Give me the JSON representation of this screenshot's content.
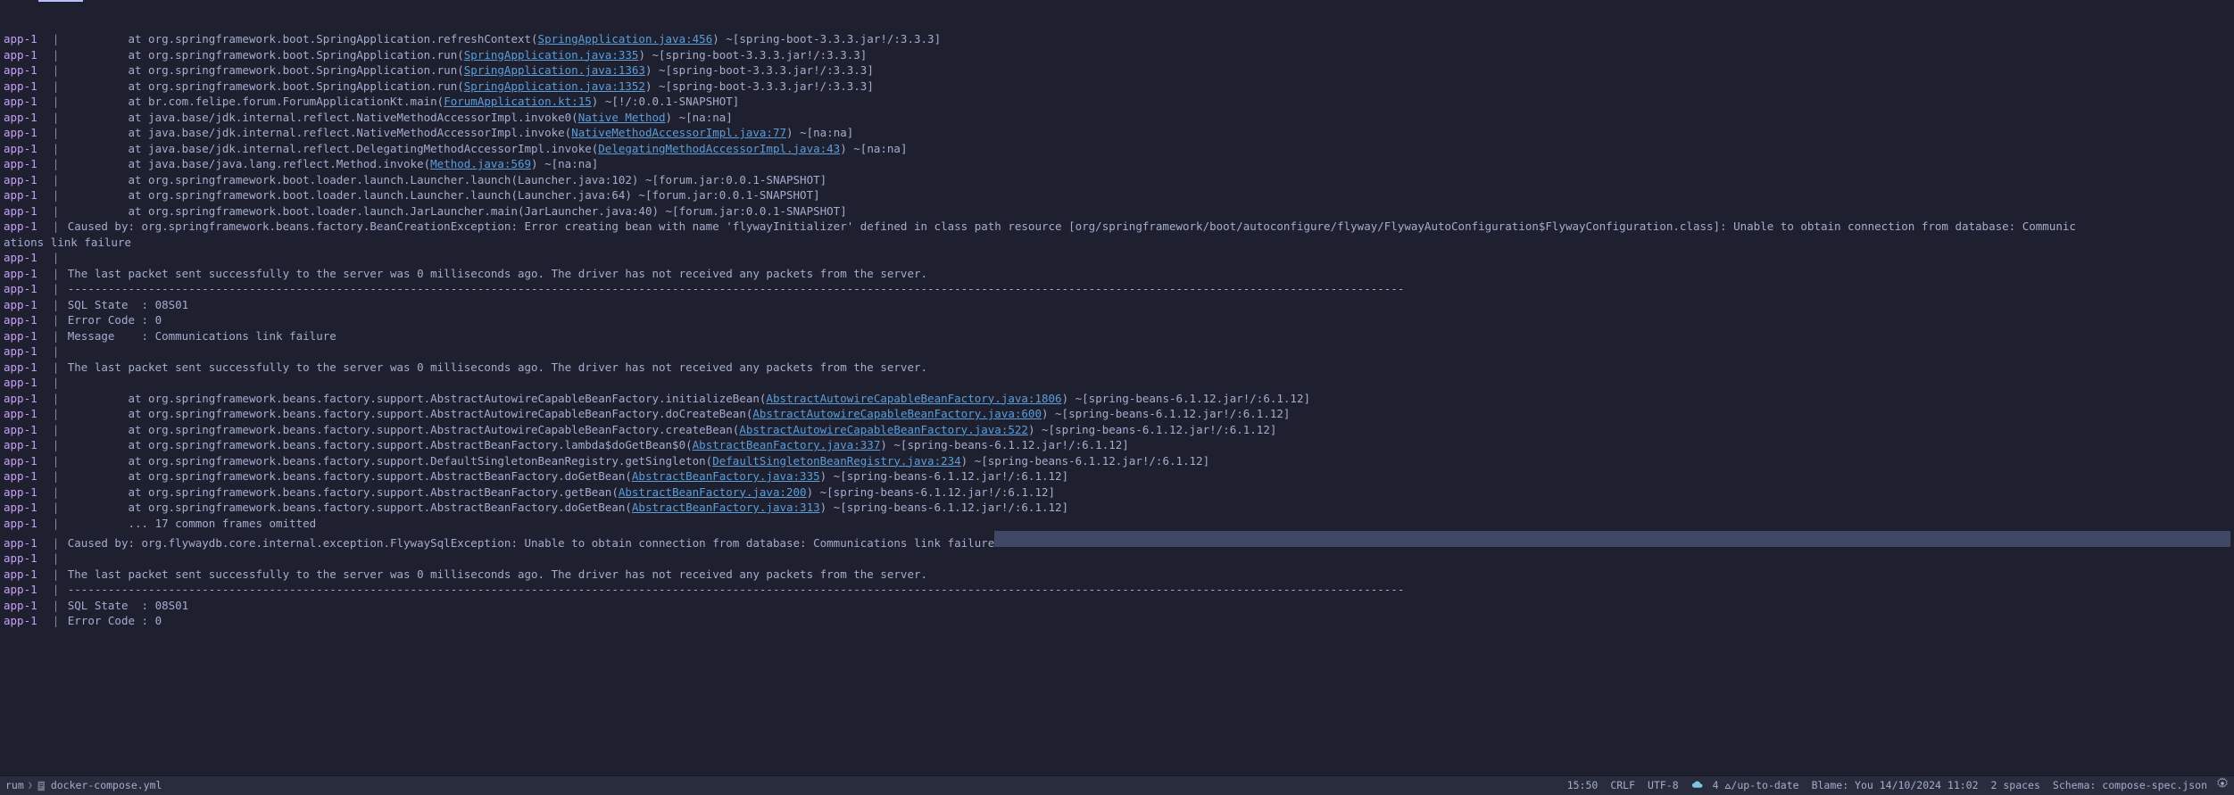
{
  "log": {
    "prefix": "app-1",
    "lines": [
      {
        "type": "stack",
        "indent": "         ",
        "pre": "at org.springframework.boot.SpringApplication.refreshContext(",
        "link": "SpringApplication.java:456",
        "post": ") ~[spring-boot-3.3.3.jar!/:3.3.3]"
      },
      {
        "type": "stack",
        "indent": "         ",
        "pre": "at org.springframework.boot.SpringApplication.run(",
        "link": "SpringApplication.java:335",
        "post": ") ~[spring-boot-3.3.3.jar!/:3.3.3]"
      },
      {
        "type": "stack",
        "indent": "         ",
        "pre": "at org.springframework.boot.SpringApplication.run(",
        "link": "SpringApplication.java:1363",
        "post": ") ~[spring-boot-3.3.3.jar!/:3.3.3]"
      },
      {
        "type": "stack",
        "indent": "         ",
        "pre": "at org.springframework.boot.SpringApplication.run(",
        "link": "SpringApplication.java:1352",
        "post": ") ~[spring-boot-3.3.3.jar!/:3.3.3]"
      },
      {
        "type": "stack",
        "indent": "         ",
        "pre": "at br.com.felipe.forum.ForumApplicationKt.main(",
        "link": "ForumApplication.kt:15",
        "post": ") ~[!/:0.0.1-SNAPSHOT]"
      },
      {
        "type": "stack",
        "indent": "         ",
        "pre": "at java.base/jdk.internal.reflect.NativeMethodAccessorImpl.invoke0(",
        "link": "Native Method",
        "post": ") ~[na:na]"
      },
      {
        "type": "stack",
        "indent": "         ",
        "pre": "at java.base/jdk.internal.reflect.NativeMethodAccessorImpl.invoke(",
        "link": "NativeMethodAccessorImpl.java:77",
        "post": ") ~[na:na]"
      },
      {
        "type": "stack",
        "indent": "         ",
        "pre": "at java.base/jdk.internal.reflect.DelegatingMethodAccessorImpl.invoke(",
        "link": "DelegatingMethodAccessorImpl.java:43",
        "post": ") ~[na:na]"
      },
      {
        "type": "stack",
        "indent": "         ",
        "pre": "at java.base/java.lang.reflect.Method.invoke(",
        "link": "Method.java:569",
        "post": ") ~[na:na]"
      },
      {
        "type": "stack",
        "indent": "         ",
        "pre": "at org.springframework.boot.loader.launch.Launcher.launch(Launcher.java:102) ~[forum.jar:0.0.1-SNAPSHOT]",
        "link": "",
        "post": ""
      },
      {
        "type": "stack",
        "indent": "         ",
        "pre": "at org.springframework.boot.loader.launch.Launcher.launch(Launcher.java:64) ~[forum.jar:0.0.1-SNAPSHOT]",
        "link": "",
        "post": ""
      },
      {
        "type": "stack",
        "indent": "         ",
        "pre": "at org.springframework.boot.loader.launch.JarLauncher.main(JarLauncher.java:40) ~[forum.jar:0.0.1-SNAPSHOT]",
        "link": "",
        "post": ""
      },
      {
        "type": "plain",
        "text": "Caused by: org.springframework.beans.factory.BeanCreationException: Error creating bean with name 'flywayInitializer' defined in class path resource [org/springframework/boot/autoconfigure/flyway/FlywayAutoConfiguration$FlywayConfiguration.class]: Unable to obtain connection from database: Communic"
      },
      {
        "type": "wrap",
        "text": "ations link failure"
      },
      {
        "type": "plain",
        "text": ""
      },
      {
        "type": "plain",
        "text": "The last packet sent successfully to the server was 0 milliseconds ago. The driver has not received any packets from the server."
      },
      {
        "type": "plain",
        "text": "-------------------------------------------------------------------------------------------------------------------------------------------------------------------------------------------------------"
      },
      {
        "type": "plain",
        "text": "SQL State  : 08S01"
      },
      {
        "type": "plain",
        "text": "Error Code : 0"
      },
      {
        "type": "plain",
        "text": "Message    : Communications link failure"
      },
      {
        "type": "plain",
        "text": ""
      },
      {
        "type": "plain",
        "text": "The last packet sent successfully to the server was 0 milliseconds ago. The driver has not received any packets from the server."
      },
      {
        "type": "plain",
        "text": ""
      },
      {
        "type": "stack",
        "indent": "         ",
        "pre": "at org.springframework.beans.factory.support.AbstractAutowireCapableBeanFactory.initializeBean(",
        "link": "AbstractAutowireCapableBeanFactory.java:1806",
        "post": ") ~[spring-beans-6.1.12.jar!/:6.1.12]"
      },
      {
        "type": "stack",
        "indent": "         ",
        "pre": "at org.springframework.beans.factory.support.AbstractAutowireCapableBeanFactory.doCreateBean(",
        "link": "AbstractAutowireCapableBeanFactory.java:600",
        "post": ") ~[spring-beans-6.1.12.jar!/:6.1.12]"
      },
      {
        "type": "stack",
        "indent": "         ",
        "pre": "at org.springframework.beans.factory.support.AbstractAutowireCapableBeanFactory.createBean(",
        "link": "AbstractAutowireCapableBeanFactory.java:522",
        "post": ") ~[spring-beans-6.1.12.jar!/:6.1.12]"
      },
      {
        "type": "stack",
        "indent": "         ",
        "pre": "at org.springframework.beans.factory.support.AbstractBeanFactory.lambda$doGetBean$0(",
        "link": "AbstractBeanFactory.java:337",
        "post": ") ~[spring-beans-6.1.12.jar!/:6.1.12]"
      },
      {
        "type": "stack",
        "indent": "         ",
        "pre": "at org.springframework.beans.factory.support.DefaultSingletonBeanRegistry.getSingleton(",
        "link": "DefaultSingletonBeanRegistry.java:234",
        "post": ") ~[spring-beans-6.1.12.jar!/:6.1.12]"
      },
      {
        "type": "stack",
        "indent": "         ",
        "pre": "at org.springframework.beans.factory.support.AbstractBeanFactory.doGetBean(",
        "link": "AbstractBeanFactory.java:335",
        "post": ") ~[spring-beans-6.1.12.jar!/:6.1.12]"
      },
      {
        "type": "stack",
        "indent": "         ",
        "pre": "at org.springframework.beans.factory.support.AbstractBeanFactory.getBean(",
        "link": "AbstractBeanFactory.java:200",
        "post": ") ~[spring-beans-6.1.12.jar!/:6.1.12]"
      },
      {
        "type": "stack",
        "indent": "         ",
        "pre": "at org.springframework.beans.factory.support.AbstractBeanFactory.doGetBean(",
        "link": "AbstractBeanFactory.java:313",
        "post": ") ~[spring-beans-6.1.12.jar!/:6.1.12]"
      },
      {
        "type": "stack",
        "indent": "         ",
        "pre": "... 17 common frames omitted",
        "link": "",
        "post": ""
      },
      {
        "type": "highlighted",
        "text": "Caused by: org.flywaydb.core.internal.exception.FlywaySqlException: Unable to obtain connection from database: Communications link failure"
      },
      {
        "type": "plain",
        "text": ""
      },
      {
        "type": "plain",
        "text": "The last packet sent successfully to the server was 0 milliseconds ago. The driver has not received any packets from the server."
      },
      {
        "type": "plain",
        "text": "-------------------------------------------------------------------------------------------------------------------------------------------------------------------------------------------------------"
      },
      {
        "type": "plain",
        "text": "SQL State  : 08S01"
      },
      {
        "type": "plain",
        "text": "Error Code : 0"
      }
    ]
  },
  "statusbar": {
    "breadcrumb_root": "rum",
    "breadcrumb_file": "docker-compose.yml",
    "cursor": "15:50",
    "line_ending": "CRLF",
    "encoding": "UTF-8",
    "sync": "4 ⩟/up-to-date",
    "blame": "Blame: You 14/10/2024 11:02",
    "indent": "2 spaces",
    "schema": "Schema: compose-spec.json"
  }
}
